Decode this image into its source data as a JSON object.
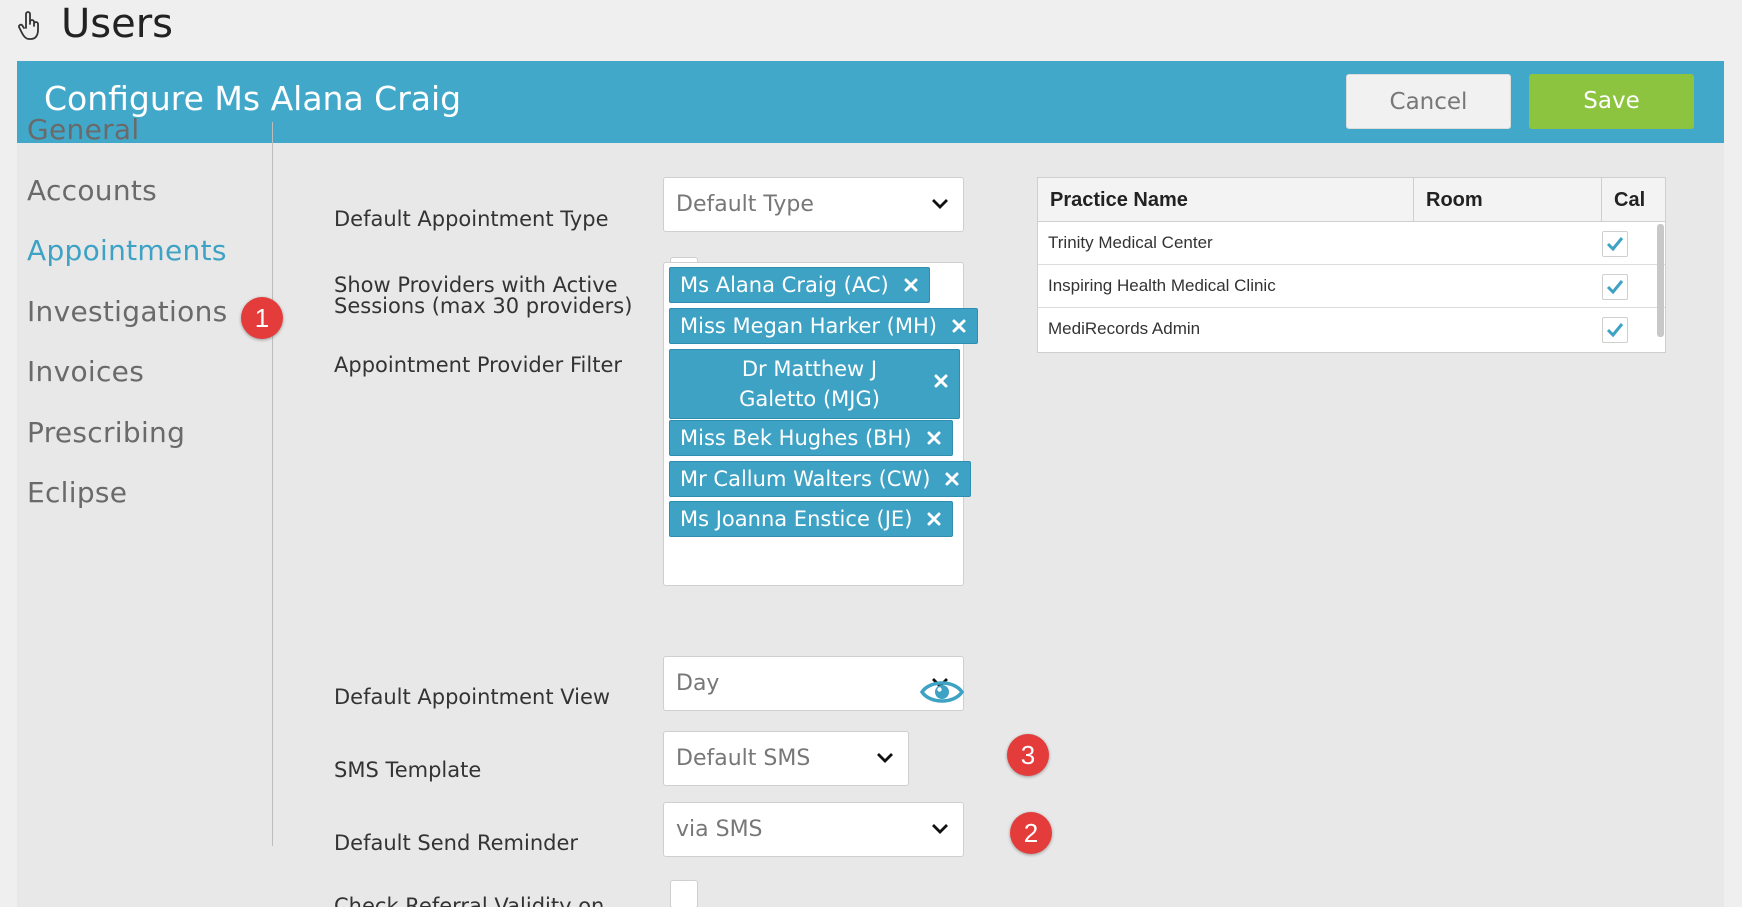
{
  "page": {
    "title": "Users"
  },
  "banner": {
    "title": "Configure Ms Alana Craig",
    "cancel_label": "Cancel",
    "save_label": "Save"
  },
  "nav": {
    "items": [
      {
        "label": "General"
      },
      {
        "label": "Accounts"
      },
      {
        "label": "Appointments",
        "active": true
      },
      {
        "label": "Investigations"
      },
      {
        "label": "Invoices"
      },
      {
        "label": "Prescribing"
      },
      {
        "label": "Eclipse"
      }
    ]
  },
  "badges": {
    "b1": "1",
    "b2": "2",
    "b3": "3"
  },
  "form": {
    "appt_type": {
      "label": "Default Appointment Type",
      "value": "Default Type"
    },
    "show_providers": {
      "label_line1": "Show Providers with Active",
      "label_line2": "Sessions (max 30 providers)",
      "checked": false
    },
    "provider_filter": {
      "label": "Appointment Provider Filter",
      "tags": [
        "Ms Alana Craig (AC)",
        "Miss Megan Harker (MH)",
        "Dr Matthew J Galetto (MJG)",
        "Miss Bek Hughes (BH)",
        "Mr Callum Walters (CW)",
        "Ms Joanna Enstice (JE)"
      ]
    },
    "appt_view": {
      "label": "Default Appointment View",
      "value": "Day"
    },
    "sms_template": {
      "label": "SMS Template",
      "value": "Default SMS"
    },
    "send_reminder": {
      "label": "Default Send Reminder",
      "value": "via SMS"
    },
    "referral": {
      "label": "Check Referral Validity on",
      "checked": false
    }
  },
  "practice_table": {
    "headers": [
      "Practice Name",
      "Room",
      "Cal"
    ],
    "rows": [
      {
        "name": "Trinity Medical Center",
        "room": "",
        "cal": true
      },
      {
        "name": "Inspiring Health Medical Clinic",
        "room": "",
        "cal": true
      },
      {
        "name": "MediRecords Admin",
        "room": "",
        "cal": true
      }
    ]
  },
  "colors": {
    "brand": "#42a8c9",
    "save": "#8cc43f",
    "badge": "#e43b3b",
    "active_nav": "#3ea2c4"
  }
}
